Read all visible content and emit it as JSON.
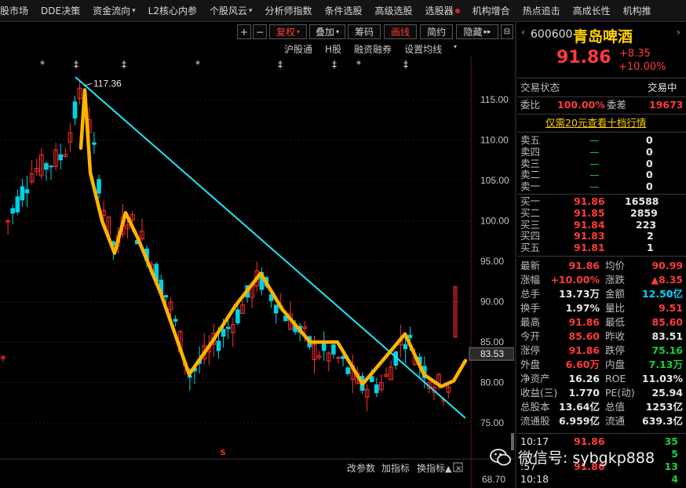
{
  "menu": [
    {
      "label": "股市场",
      "dropdown": false
    },
    {
      "label": "DDE决策",
      "dropdown": false
    },
    {
      "label": "资金流向",
      "dropdown": true
    },
    {
      "label": "L2核心内参",
      "dropdown": false
    },
    {
      "label": "个股风云",
      "dropdown": true
    },
    {
      "label": "分析师指数",
      "dropdown": false
    },
    {
      "label": "条件选股",
      "dropdown": false
    },
    {
      "label": "高级选股",
      "dropdown": false
    },
    {
      "label": "选股器",
      "dropdown": false,
      "dot": true
    },
    {
      "label": "机构增合",
      "dropdown": false
    },
    {
      "label": "热点追击",
      "dropdown": false
    },
    {
      "label": "高成长性",
      "dropdown": false
    },
    {
      "label": "机构推",
      "dropdown": false
    }
  ],
  "toolbar": {
    "plus": "+",
    "minus": "−",
    "fuquan": "复权",
    "overlay": "叠加",
    "chips": "筹码",
    "draw": "画线",
    "simple": "简约",
    "hide": "隐藏",
    "collapse": "▸▸",
    "pin": "⊟"
  },
  "subbar": [
    "沪股通",
    "H股",
    "融资融券",
    "设置均线"
  ],
  "chart": {
    "price_labels": [
      "115.00",
      "110.00",
      "105.00",
      "100.00",
      "95.00",
      "90.00",
      "85.00",
      "80.00",
      "75.00"
    ],
    "current_price_tag": "83.53",
    "bottom_axis_label": "68.70",
    "peak_label": "117.36",
    "indicator_buttons": [
      "改参数",
      "加指标",
      "换指标"
    ],
    "marker_s": "S",
    "candle_up": "#ff3030",
    "candle_down": "#00d2e6",
    "trend_line_color": "#20e6ff",
    "zigzag_color": "#ffb400"
  },
  "chart_data": {
    "type": "candlestick",
    "ylim": [
      73,
      120
    ],
    "annotations": [
      "117.36",
      "83.53"
    ],
    "peak": 117.36,
    "last_close": 83.53
  },
  "quote": {
    "code": "600600",
    "name": "青岛啤酒",
    "price": "91.86",
    "change": "+8.35",
    "change_pct": "+10.00%"
  },
  "status": {
    "label": "交易状态",
    "value": "交易中"
  },
  "weibi": {
    "label": "委比",
    "value": "100.00%",
    "label2": "委差",
    "value2": "19673"
  },
  "promo": "仅需20元查看十档行情",
  "asks": [
    {
      "label": "卖五",
      "price": "—",
      "vol": "0"
    },
    {
      "label": "卖四",
      "price": "—",
      "vol": "0"
    },
    {
      "label": "卖三",
      "price": "—",
      "vol": "0"
    },
    {
      "label": "卖二",
      "price": "—",
      "vol": "0"
    },
    {
      "label": "卖一",
      "price": "—",
      "vol": "0"
    }
  ],
  "bids": [
    {
      "label": "买一",
      "price": "91.86",
      "vol": "16588"
    },
    {
      "label": "买二",
      "price": "91.85",
      "vol": "2859"
    },
    {
      "label": "买三",
      "price": "91.84",
      "vol": "223"
    },
    {
      "label": "买四",
      "price": "91.83",
      "vol": "2"
    },
    {
      "label": "买五",
      "price": "91.81",
      "vol": "1"
    }
  ],
  "stats": [
    {
      "l1": "最新",
      "v1": "91.86",
      "c1": "red",
      "l2": "均价",
      "v2": "90.99",
      "c2": "red"
    },
    {
      "l1": "涨幅",
      "v1": "+10.00%",
      "c1": "red",
      "l2": "涨跌",
      "v2": "▲8.35",
      "c2": "red"
    },
    {
      "l1": "总手",
      "v1": "13.73万",
      "c1": "white",
      "l2": "金额",
      "v2": "12.50亿",
      "c2": "cyan"
    },
    {
      "l1": "换手",
      "v1": "1.97%",
      "c1": "white",
      "l2": "量比",
      "v2": "9.51",
      "c2": "red"
    },
    {
      "l1": "最高",
      "v1": "91.86",
      "c1": "red",
      "l2": "最低",
      "v2": "85.60",
      "c2": "red"
    },
    {
      "l1": "今开",
      "v1": "85.60",
      "c1": "red",
      "l2": "昨收",
      "v2": "83.51",
      "c2": "white"
    },
    {
      "l1": "涨停",
      "v1": "91.86",
      "c1": "red",
      "l2": "跌停",
      "v2": "75.16",
      "c2": "green"
    },
    {
      "l1": "外盘",
      "v1": "6.60万",
      "c1": "red",
      "l2": "内盘",
      "v2": "7.13万",
      "c2": "green"
    },
    {
      "l1": "净资产",
      "v1": "16.26",
      "c1": "white",
      "l2": "ROE",
      "v2": "11.03%",
      "c2": "white"
    },
    {
      "l1": "收益(三)",
      "v1": "1.770",
      "c1": "white",
      "l2": "PE(动)",
      "v2": "25.94",
      "c2": "white"
    },
    {
      "l1": "总股本",
      "v1": "13.64亿",
      "c1": "white",
      "l2": "总值",
      "v2": "1253亿",
      "c2": "white"
    },
    {
      "l1": "流通股",
      "v1": "6.959亿",
      "c1": "white",
      "l2": "流通",
      "v2": "639.3亿",
      "c2": "white"
    }
  ],
  "ticks": [
    {
      "time": "10:17",
      "price": "91.86",
      "vol": "35"
    },
    {
      "time": "",
      "price": "",
      "vol": "5"
    },
    {
      "time": ":57",
      "price": "91.86",
      "vol": "13"
    },
    {
      "time": "10:18",
      "price": "",
      "vol": "4"
    }
  ],
  "watermark": "微信号: sybgkp888"
}
